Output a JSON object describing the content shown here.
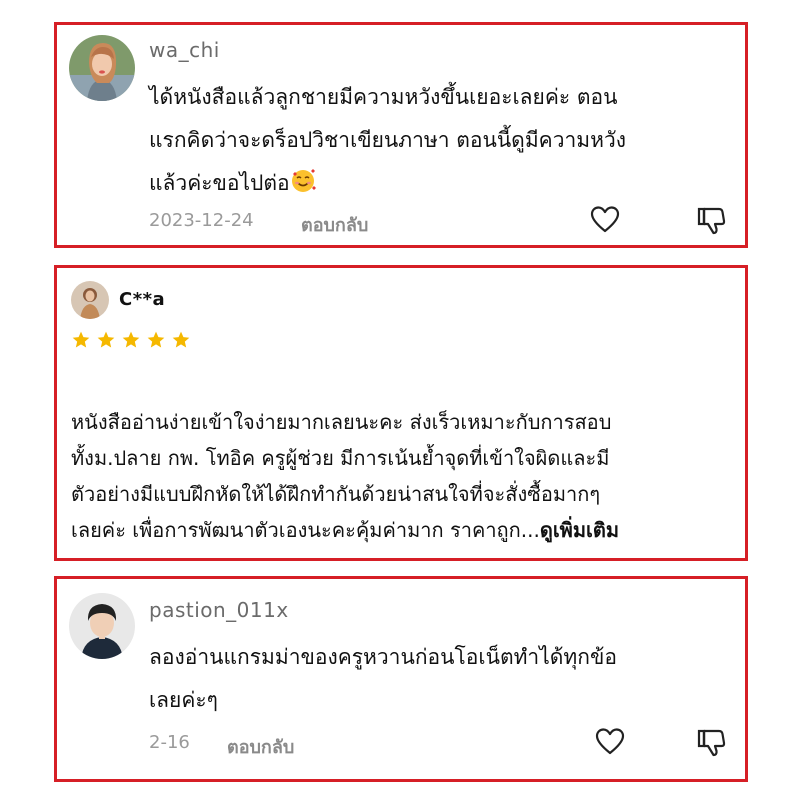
{
  "comments": [
    {
      "username": "wa_chi",
      "text_lines": [
        "ได้หนังสือแล้วลูกชายมีความหวังขึ้นเยอะเลยค่ะ ตอน",
        "แรกคิดว่าจะดร็อปวิชาเขียนภาษา ตอนนี้ดูมีความหวัง",
        "แล้วค่ะขอไปต่อ"
      ],
      "emoji": "smiling-face-with-hearts",
      "date": "2023-12-24",
      "reply_label": "ตอบกลับ"
    },
    {
      "username": "C**a",
      "rating": 5,
      "text_lines": [
        "หนังสืออ่านง่ายเข้าใจง่ายมากเลยนะคะ ส่งเร็วเหมาะกับการสอบ",
        "ทั้งม.ปลาย กพ. โทอิค ครูผู้ช่วย มีการเน้นย้ำจุดที่เข้าใจผิดและมี",
        "ตัวอย่างมีแบบฝึกหัดให้ได้ฝึกทำกันด้วยน่าสนใจที่จะสั่งซื้อมากๆ",
        "เลยค่ะ เพื่อการพัฒนาตัวเองนะคะคุ้มค่ามาก ราคาถูก..."
      ],
      "see_more_label": "ดูเพิ่มเติม"
    },
    {
      "username": "pastion_011x",
      "text_lines": [
        "ลองอ่านแกรมม่าของครูหวานก่อนโอเน็ตทำได้ทุกข้อ",
        "เลยค่ะๆ"
      ],
      "date": "2-16",
      "reply_label": "ตอบกลับ"
    }
  ],
  "colors": {
    "highlight_border": "#d61f26",
    "star": "#f5b800"
  }
}
